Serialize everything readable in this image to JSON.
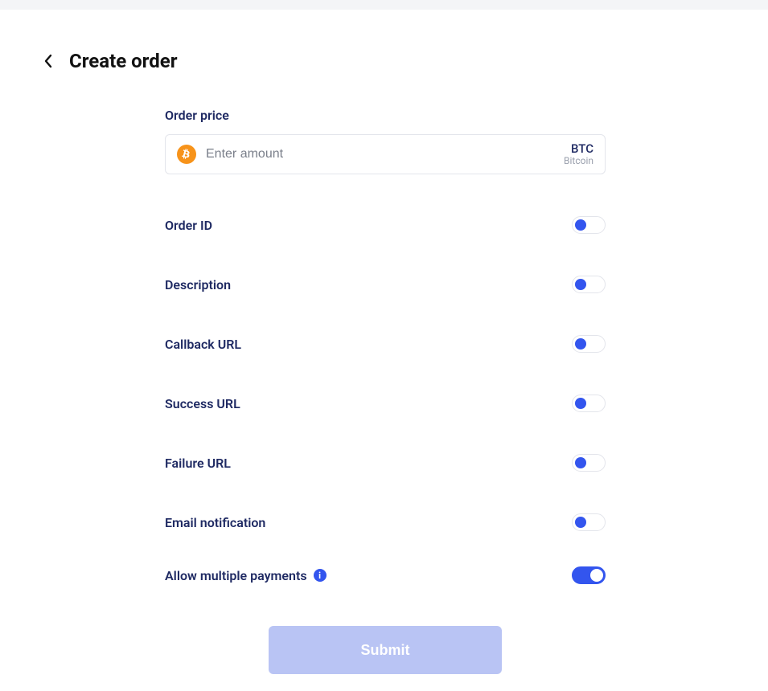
{
  "header": {
    "title": "Create order"
  },
  "price": {
    "label": "Order price",
    "placeholder": "Enter amount",
    "currency_code": "BTC",
    "currency_name": "Bitcoin"
  },
  "toggles": {
    "order_id": {
      "label": "Order ID",
      "on": false
    },
    "description": {
      "label": "Description",
      "on": false
    },
    "callback_url": {
      "label": "Callback URL",
      "on": false
    },
    "success_url": {
      "label": "Success URL",
      "on": false
    },
    "failure_url": {
      "label": "Failure URL",
      "on": false
    },
    "email_notification": {
      "label": "Email notification",
      "on": false
    },
    "allow_multiple": {
      "label": "Allow multiple payments",
      "on": true,
      "has_info": true
    }
  },
  "submit_label": "Submit",
  "colors": {
    "accent": "#3355ee",
    "label": "#1f2a63",
    "submit_bg": "#b9c4f4"
  }
}
